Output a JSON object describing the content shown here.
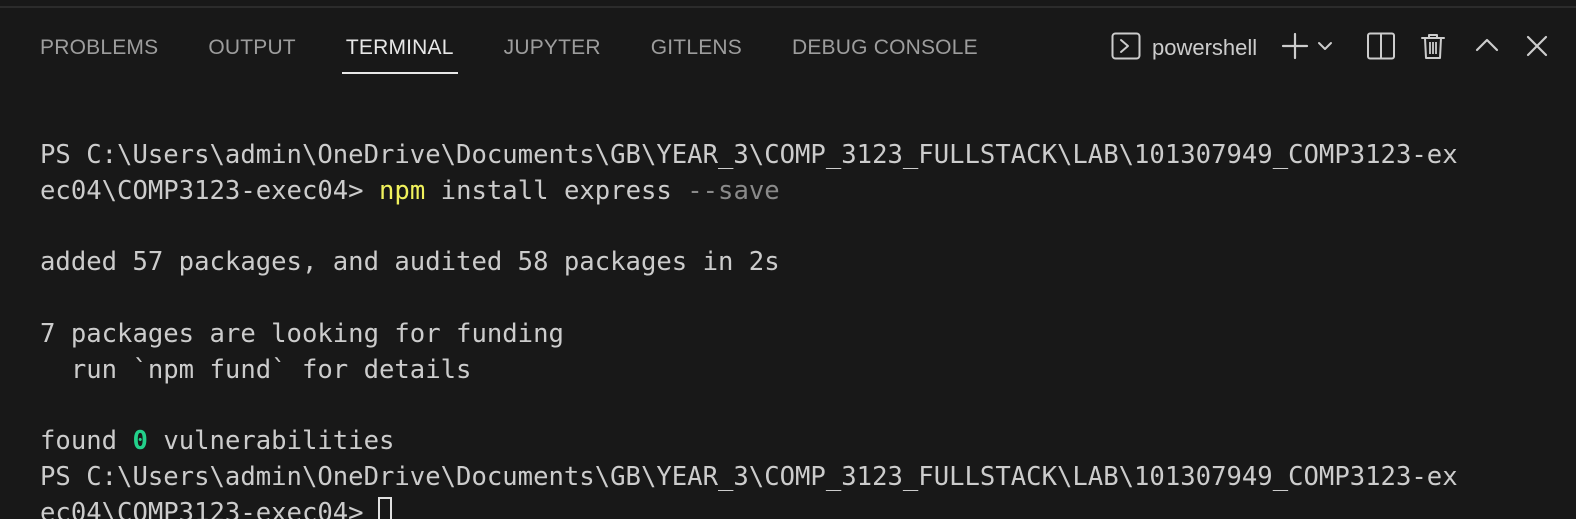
{
  "panel": {
    "tabs": [
      {
        "label": "PROBLEMS",
        "active": false
      },
      {
        "label": "OUTPUT",
        "active": false
      },
      {
        "label": "TERMINAL",
        "active": true
      },
      {
        "label": "JUPYTER",
        "active": false
      },
      {
        "label": "GITLENS",
        "active": false
      },
      {
        "label": "DEBUG CONSOLE",
        "active": false
      }
    ],
    "shell_name": "powershell",
    "icons": {
      "shell": "terminal-powershell-icon",
      "new": "plus-icon",
      "dropdown": "chevron-down-icon",
      "split": "split-editor-icon",
      "kill": "trash-icon",
      "maximize": "chevron-up-icon",
      "close": "close-icon"
    }
  },
  "terminal": {
    "prompt_line1": "PS C:\\Users\\admin\\OneDrive\\Documents\\GB\\YEAR_3\\COMP_3123_FULLSTACK\\LAB\\101307949_COMP3123-ex",
    "prompt_line2": "ec04\\COMP3123-exec04>",
    "cmd_name": "npm",
    "cmd_args": "install express",
    "cmd_flag": "--save",
    "added_line": "added 57 packages, and audited 58 packages in 2s",
    "funding_line": "7 packages are looking for funding",
    "fund_hint_line": "  run `npm fund` for details",
    "found_prefix": "found",
    "found_count": "0",
    "found_suffix": "vulnerabilities",
    "prompt2_line1": "PS C:\\Users\\admin\\OneDrive\\Documents\\GB\\YEAR_3\\COMP_3123_FULLSTACK\\LAB\\101307949_COMP3123-ex",
    "prompt2_line2": "ec04\\COMP3123-exec04>"
  },
  "colors": {
    "background": "#181818",
    "text": "#cccccc",
    "command_yellow": "#f0f15c",
    "flag_gray": "#8a8a8a",
    "count_green": "#23d18b"
  }
}
